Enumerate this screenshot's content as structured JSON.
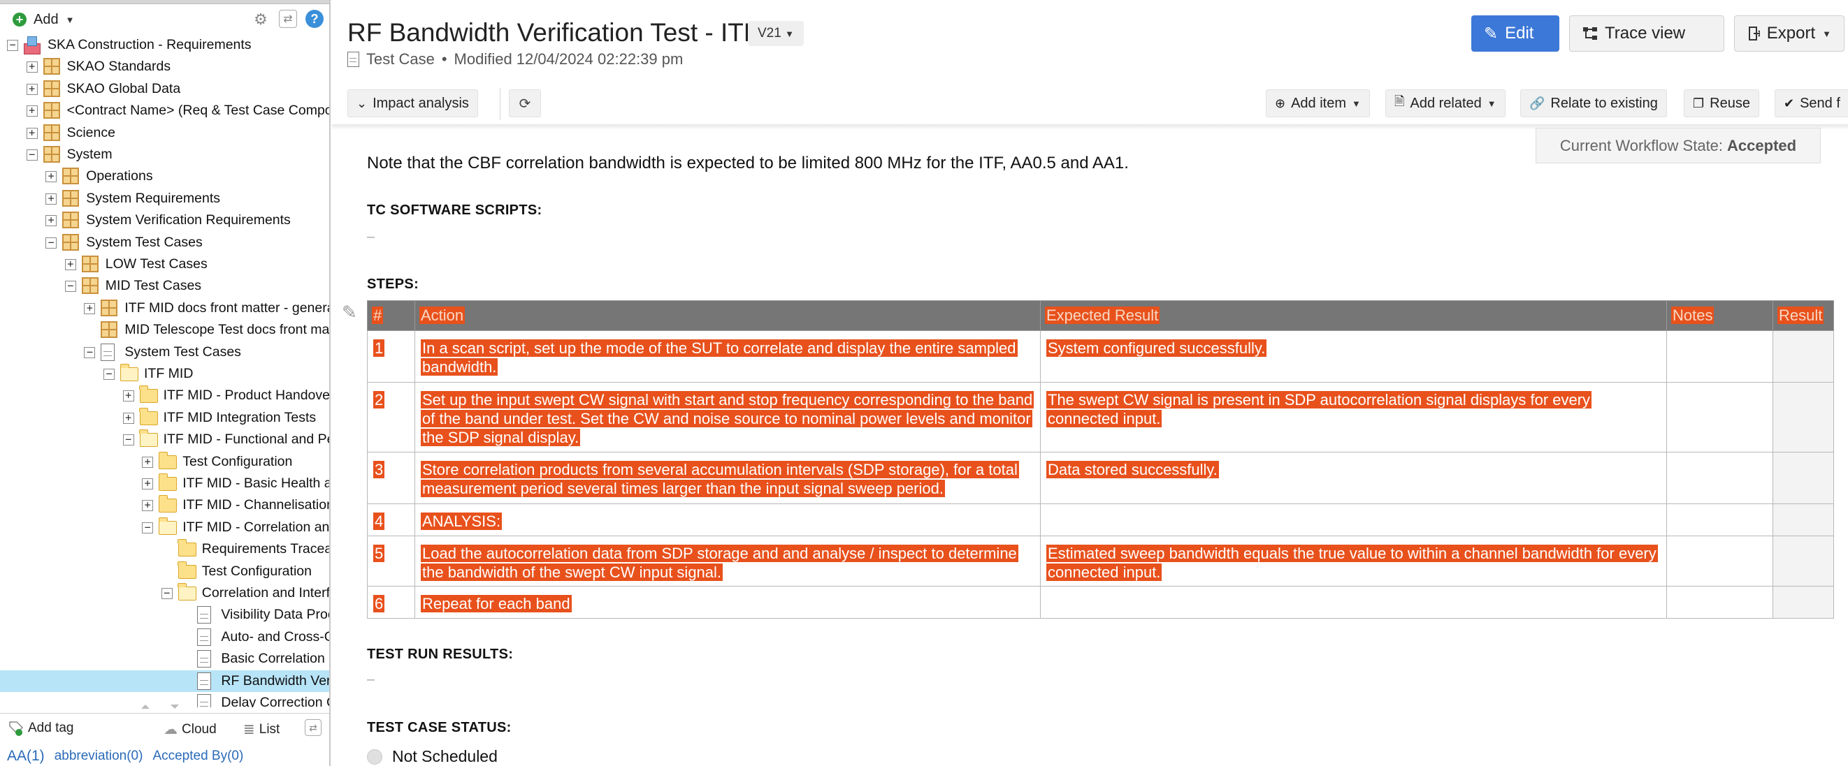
{
  "left_panel": {
    "add_label": "Add",
    "tree": [
      {
        "label": "SKA Construction - Requirements",
        "depth": 0,
        "toggle": "minus",
        "icon": "root"
      },
      {
        "label": "SKAO Standards",
        "depth": 1,
        "toggle": "plus",
        "icon": "grid"
      },
      {
        "label": "SKAO Global Data",
        "depth": 1,
        "toggle": "plus",
        "icon": "grid"
      },
      {
        "label": "<Contract Name> (Req & Test Case Compor",
        "depth": 1,
        "toggle": "plus",
        "icon": "grid"
      },
      {
        "label": "Science",
        "depth": 1,
        "toggle": "plus",
        "icon": "grid"
      },
      {
        "label": "System",
        "depth": 1,
        "toggle": "minus",
        "icon": "grid"
      },
      {
        "label": "Operations",
        "depth": 2,
        "toggle": "plus",
        "icon": "grid"
      },
      {
        "label": "System Requirements",
        "depth": 2,
        "toggle": "plus",
        "icon": "grid"
      },
      {
        "label": "System Verification Requirements",
        "depth": 2,
        "toggle": "plus",
        "icon": "grid"
      },
      {
        "label": "System Test Cases",
        "depth": 2,
        "toggle": "minus",
        "icon": "grid"
      },
      {
        "label": "LOW Test Cases",
        "depth": 3,
        "toggle": "plus",
        "icon": "grid"
      },
      {
        "label": "MID Test Cases",
        "depth": 3,
        "toggle": "minus",
        "icon": "grid"
      },
      {
        "label": "ITF MID docs front matter - genera",
        "depth": 4,
        "toggle": "plus",
        "icon": "grid"
      },
      {
        "label": "MID Telescope Test docs front matt",
        "depth": 4,
        "toggle": "none",
        "icon": "grid"
      },
      {
        "label": "System Test Cases",
        "depth": 4,
        "toggle": "minus",
        "icon": "doc"
      },
      {
        "label": "ITF MID",
        "depth": 5,
        "toggle": "minus",
        "icon": "folder-open"
      },
      {
        "label": "ITF MID - Product Handover",
        "depth": 6,
        "toggle": "plus",
        "icon": "folder"
      },
      {
        "label": "ITF MID Integration Tests",
        "depth": 6,
        "toggle": "plus",
        "icon": "folder"
      },
      {
        "label": "ITF MID - Functional and Pe",
        "depth": 6,
        "toggle": "minus",
        "icon": "folder-open"
      },
      {
        "label": "Test Configuration",
        "depth": 7,
        "toggle": "plus",
        "icon": "folder"
      },
      {
        "label": "ITF MID - Basic Health ar",
        "depth": 7,
        "toggle": "plus",
        "icon": "folder"
      },
      {
        "label": "ITF MID - Channelisation",
        "depth": 7,
        "toggle": "plus",
        "icon": "folder"
      },
      {
        "label": "ITF MID - Correlation and",
        "depth": 7,
        "toggle": "minus",
        "icon": "folder-open"
      },
      {
        "label": "Requirements Traceal",
        "depth": 8,
        "toggle": "none",
        "icon": "folder"
      },
      {
        "label": "Test Configuration",
        "depth": 8,
        "toggle": "none",
        "icon": "folder"
      },
      {
        "label": "Correlation and Interfe",
        "depth": 8,
        "toggle": "minus",
        "icon": "folder-open"
      },
      {
        "label": "Visibility Data Proc",
        "depth": 9,
        "toggle": "none",
        "icon": "doc"
      },
      {
        "label": "Auto- and Cross-C",
        "depth": 9,
        "toggle": "none",
        "icon": "doc"
      },
      {
        "label": "Basic Correlation &",
        "depth": 9,
        "toggle": "none",
        "icon": "doc"
      },
      {
        "label": "RF Bandwidth Veri",
        "depth": 9,
        "toggle": "none",
        "icon": "doc",
        "selected": true
      },
      {
        "label": "Delay Correction C",
        "depth": 9,
        "toggle": "none",
        "icon": "doc"
      }
    ],
    "tagbar": {
      "add_tag": "Add tag",
      "cloud": "Cloud",
      "list": "List"
    },
    "tags": [
      "AA(1)",
      "abbreviation(0)",
      "Accepted By(0)"
    ]
  },
  "header": {
    "title": "RF Bandwidth Verification Test - ITF",
    "version": "V21",
    "item_type": "Test Case",
    "bullet": "•",
    "modified": "Modified 12/04/2024 02:22:39 pm",
    "edit": "Edit",
    "trace_view": "Trace view",
    "export": "Export"
  },
  "toolbar": {
    "impact_analysis": "Impact analysis",
    "add_item": "Add item",
    "add_related": "Add related",
    "relate_existing": "Relate to existing",
    "reuse": "Reuse",
    "send": "Send f"
  },
  "workflow": {
    "label": "Current Workflow State:",
    "state": "Accepted"
  },
  "content": {
    "note": "Note that the CBF correlation bandwidth is expected to be limited 800 MHz for the ITF, AA0.5 and AA1.",
    "scripts_heading": "TC SOFTWARE SCRIPTS:",
    "scripts_value": "–",
    "steps_heading": "STEPS:",
    "columns": [
      "#",
      "Action",
      "Expected Result",
      "Notes",
      "Result"
    ],
    "steps": [
      {
        "num": "1",
        "action": "In a scan script, set up the mode of the SUT to correlate and display the entire sampled bandwidth.",
        "expected": "System configured successfully."
      },
      {
        "num": "2",
        "action": "Set up the input swept CW signal with start and stop frequency corresponding to the band of the band under test. Set the CW and noise source to nominal power levels and monitor the SDP signal display.",
        "expected": "The swept CW signal is present in SDP autocorrelation signal displays for every connected input."
      },
      {
        "num": "3",
        "action": "Store correlation products from several accumulation intervals (SDP storage), for a total measurement period several times larger than the input signal sweep period.",
        "expected": "Data stored successfully."
      },
      {
        "num": "4",
        "action": "ANALYSIS:",
        "expected": ""
      },
      {
        "num": "5",
        "action": "Load the autocorrelation data from SDP storage and and analyse / inspect to determine the bandwidth of the swept CW input signal.",
        "expected": "Estimated sweep bandwidth equals the true value to within a channel bandwidth for every connected input."
      },
      {
        "num": "6",
        "action": "Repeat for each band",
        "expected": ""
      }
    ],
    "results_heading": "TEST RUN RESULTS:",
    "results_value": "–",
    "status_heading": "TEST CASE STATUS:",
    "status_value": "Not Scheduled"
  }
}
